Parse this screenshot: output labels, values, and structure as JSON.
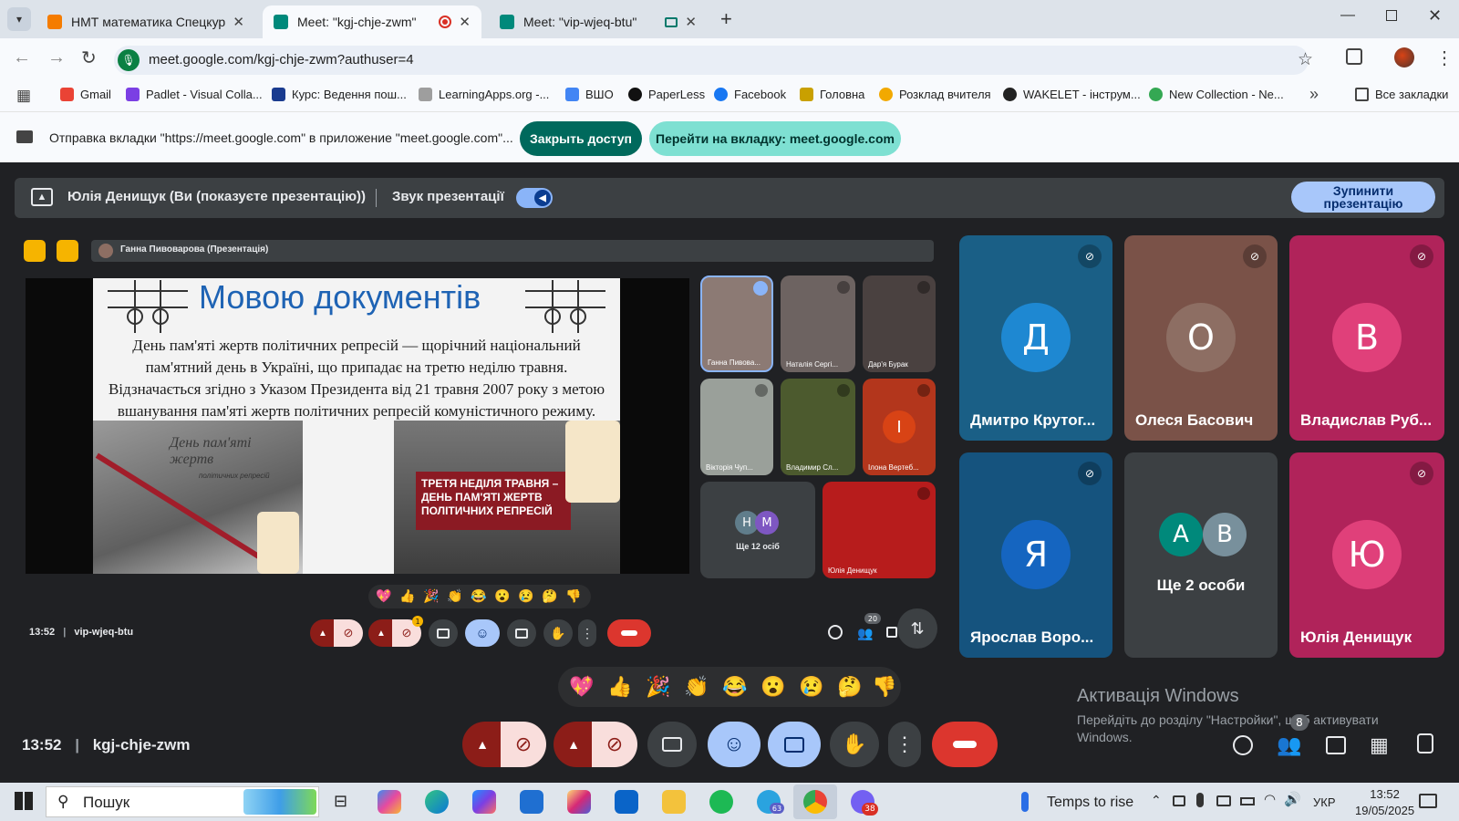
{
  "browser": {
    "tabs": [
      {
        "title": "НМТ математика Спецкурс 20",
        "favicon_color": "#f57c00",
        "active": false
      },
      {
        "title": "Meet: \"kgj-chje-zwm\"",
        "favicon_color": "#00897b",
        "active": true
      },
      {
        "title": "Meet: \"vip-wjeq-btu\"",
        "favicon_color": "#00897b",
        "active": false
      }
    ],
    "url": "meet.google.com/kgj-chje-zwm?authuser=4",
    "bookmarks": [
      "Gmail",
      "Padlet - Visual Colla...",
      "Курс: Ведення пош...",
      "LearningApps.org -...",
      "ВШО",
      "PaperLess",
      "Facebook",
      "Головна",
      "Розклад вчителя",
      "WAKELET - інструм...",
      "New Collection - Ne..."
    ],
    "all_bookmarks": "Все закладки",
    "more": "»"
  },
  "sharebar": {
    "message": "Отправка вкладки \"https://meet.google.com\" в приложение \"meet.google.com\"...",
    "stop_access": "Закрыть доступ",
    "go_to_tab": "Перейти на вкладку: meet.google.com"
  },
  "presenting": {
    "label": "Юлія Денищук (Ви (показуєте презентацію))",
    "audio_label": "Звук презентації",
    "stop_button": "Зупинити презентацію"
  },
  "inner_meet": {
    "presenter_label": "Ганна Пивоварова (Презентація)",
    "slide_title": "Мовою документів",
    "slide_lines": [
      "День пам'яті жертв політичних репресій — щорічний національний",
      "пам'ятний день в Україні, що припадає на третю неділю травня.",
      "Відзначається згідно з Указом Президента від 21 травня 2007 року з метою",
      "вшанування пам'яті жертв політичних репресій комуністичного режиму."
    ],
    "slide_left_caption": "День пам'яті жертв",
    "slide_left_sub": "політичних репресій",
    "slide_right_caption": "ТРЕТЯ НЕДІЛЯ ТРАВНЯ – ДЕНЬ ПАМ'ЯТІ ЖЕРТВ ПОЛІТИЧНИХ РЕПРЕСІЙ",
    "participants": [
      "Ганна Пивова...",
      "Наталія Сергі...",
      "Дар'я Бурак",
      "Вікторія Чуп...",
      "Владимир Сл...",
      "Ілона Вертеб...",
      "Юлія Денищук"
    ],
    "more_label": "Ще 12 осіб",
    "more_initials": [
      "Н",
      "М"
    ],
    "ilona_initial": "І",
    "time": "13:52",
    "code": "vip-wjeq-btu",
    "people_count": "20",
    "camera_badge": "1",
    "emojis": [
      "💖",
      "👍",
      "🎉",
      "👏",
      "😂",
      "😮",
      "😢",
      "🤔",
      "👎"
    ]
  },
  "tiles": [
    {
      "initial": "Д",
      "name": "Дмитро Крутог...",
      "bg": "#1a5f86",
      "avatar": "#1e88d2"
    },
    {
      "initial": "О",
      "name": "Олеся Басович",
      "bg": "#7a5248",
      "avatar": "#8d6e63"
    },
    {
      "initial": "В",
      "name": "Владислав Руб...",
      "bg": "#b0235a",
      "avatar": "#e0407a"
    },
    {
      "initial": "Я",
      "name": "Ярослав Воро...",
      "bg": "#15537e",
      "avatar": "#1565c0"
    },
    {
      "initials": [
        "А",
        "В"
      ],
      "name": "Ще 2 особи",
      "bg": "#3c4043"
    },
    {
      "initial": "Ю",
      "name": "Юлія Денищук",
      "bg": "#b0235a",
      "avatar": "#e0407a"
    }
  ],
  "meeting": {
    "time": "13:52",
    "code": "kgj-chje-zwm",
    "people_badge": "8",
    "emojis": [
      "💖",
      "👍",
      "🎉",
      "👏",
      "😂",
      "😮",
      "😢",
      "🤔",
      "👎"
    ]
  },
  "watermark": {
    "title": "Активація Windows",
    "line1": "Перейдіть до розділу \"Настройки\", щоб активувати",
    "line2": "Windows."
  },
  "taskbar": {
    "search": "Пошук",
    "weather": "Temps to rise",
    "lang": "УКР",
    "time": "13:52",
    "date": "19/05/2025",
    "teams_badge": "63",
    "viber_badge": "38"
  }
}
